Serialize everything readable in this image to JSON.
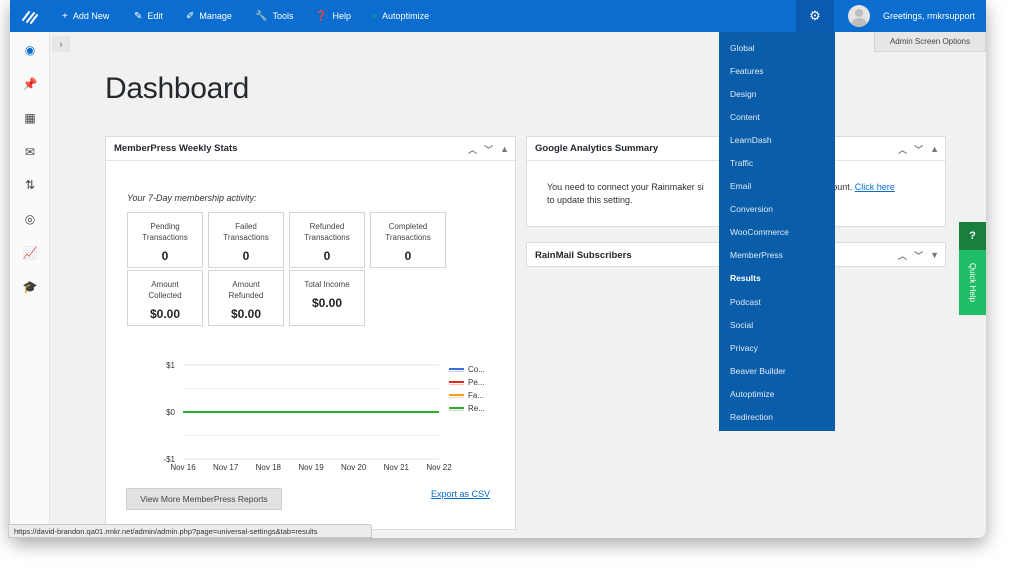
{
  "colors": {
    "topbar": "#0a6dcf",
    "dropdown": "#0a5ea9",
    "quick_help_dark": "#1a7f3e",
    "quick_help": "#1fbd67",
    "link": "#0a6dcf"
  },
  "topbar": {
    "logo_icon": "rainmaker-logo-icon",
    "items": [
      {
        "icon": "+",
        "label": "Add New"
      },
      {
        "icon": "✎",
        "label": "Edit"
      },
      {
        "icon": "✐",
        "label": "Manage"
      },
      {
        "icon": "🔧",
        "label": "Tools"
      },
      {
        "icon": "❓",
        "label": "Help"
      },
      {
        "icon": "○",
        "label": "Autoptimize"
      }
    ],
    "gear_icon": "⚙",
    "greeting": "Greetings, rmkrsupport"
  },
  "screen_options": "Admin Screen Options",
  "page_title": "Dashboard",
  "memberpress": {
    "title": "MemberPress Weekly Stats",
    "intro": "Your 7-Day membership activity:",
    "stats": [
      {
        "label_line1": "Pending",
        "label_line2": "Transactions",
        "value": "0"
      },
      {
        "label_line1": "Failed",
        "label_line2": "Transactions",
        "value": "0"
      },
      {
        "label_line1": "Refunded",
        "label_line2": "Transactions",
        "value": "0"
      },
      {
        "label_line1": "Completed",
        "label_line2": "Transactions",
        "value": "0"
      },
      {
        "label_line1": "Amount",
        "label_line2": "Collected",
        "value": "$0.00"
      },
      {
        "label_line1": "Amount",
        "label_line2": "Refunded",
        "value": "$0.00"
      },
      {
        "label_line1": "Total Income",
        "label_line2": "",
        "value": "$0.00"
      }
    ],
    "more_button": "View More MemberPress Reports",
    "export_link": "Export as CSV"
  },
  "chart_data": {
    "type": "line",
    "categories": [
      "Nov 16",
      "Nov 17",
      "Nov 18",
      "Nov 19",
      "Nov 20",
      "Nov 21",
      "Nov 22"
    ],
    "ylim": [
      -1,
      1
    ],
    "yticks": [
      "$1",
      "$0",
      "-$1"
    ],
    "grid": true,
    "legend_position": "right",
    "series": [
      {
        "name": "Co...",
        "color": "#3b6fd4",
        "values": [
          0,
          0,
          0,
          0,
          0,
          0,
          0
        ]
      },
      {
        "name": "Pe...",
        "color": "#e0281f",
        "values": [
          0,
          0,
          0,
          0,
          0,
          0,
          0
        ]
      },
      {
        "name": "Fa...",
        "color": "#f2a31b",
        "values": [
          0,
          0,
          0,
          0,
          0,
          0,
          0
        ]
      },
      {
        "name": "Re...",
        "color": "#2ea82e",
        "values": [
          0,
          0,
          0,
          0,
          0,
          0,
          0
        ]
      }
    ]
  },
  "analytics": {
    "title": "Google Analytics Summary",
    "text_before": "You need to connect your Rainmaker si",
    "text_middle": " account. ",
    "link": "Click here",
    "text_after": "to update this setting."
  },
  "rainmail": {
    "title": "RainMail Subscribers"
  },
  "dropdown": {
    "items": [
      "Global",
      "Features",
      "Design",
      "Content",
      "LearnDash",
      "Traffic",
      "Email",
      "Conversion",
      "WooCommerce",
      "MemberPress",
      "Results",
      "Podcast",
      "Social",
      "Privacy",
      "Beaver Builder",
      "Autoptimize",
      "Redirection"
    ],
    "active": "Results"
  },
  "quick_help": {
    "icon": "?",
    "label": "Quick Help"
  },
  "status_url": "https://david-brandon.qa01.rmkr.net/admin/admin.php?page=universal-settings&tab=results",
  "sidebar": {
    "icons": [
      {
        "name": "dashboard-gauge-icon",
        "glyph": "◉"
      },
      {
        "name": "pin-icon",
        "glyph": "📌"
      },
      {
        "name": "grid-icon",
        "glyph": "▦"
      },
      {
        "name": "mail-icon",
        "glyph": "✉"
      },
      {
        "name": "arrows-icon",
        "glyph": "⇅"
      },
      {
        "name": "target-icon",
        "glyph": "◎"
      },
      {
        "name": "chart-icon",
        "glyph": "📈"
      },
      {
        "name": "graduation-cap-icon",
        "glyph": "🎓"
      }
    ]
  }
}
